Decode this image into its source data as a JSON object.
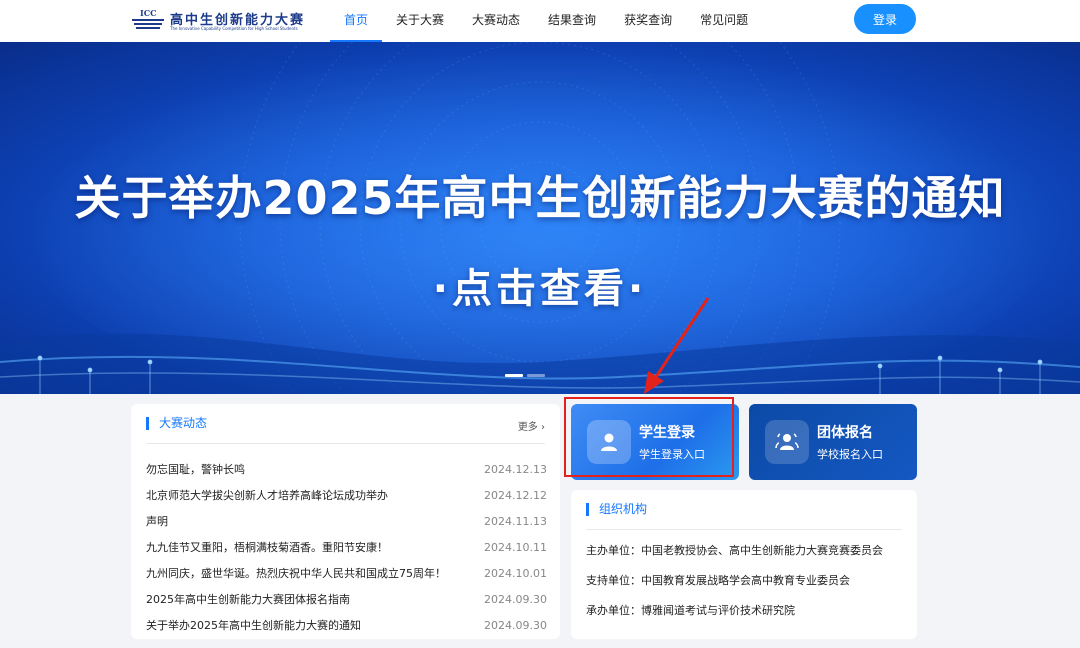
{
  "header": {
    "logo": {
      "abbr": "ICC",
      "name": "高中生创新能力大赛",
      "subtitle": "The Innovative Capability Competition for High School Students"
    },
    "nav": [
      {
        "label": "首页",
        "active": true
      },
      {
        "label": "关于大赛",
        "active": false
      },
      {
        "label": "大赛动态",
        "active": false
      },
      {
        "label": "结果查询",
        "active": false
      },
      {
        "label": "获奖查询",
        "active": false
      },
      {
        "label": "常见问题",
        "active": false
      }
    ],
    "login_label": "登录"
  },
  "banner": {
    "title": "关于举办2025年高中生创新能力大赛的通知",
    "cta": "·点击查看·",
    "slide_count": 2,
    "active_slide": 1
  },
  "news": {
    "title": "大赛动态",
    "more": "更多 ›",
    "items": [
      {
        "title": "勿忘国耻，警钟长鸣",
        "date": "2024.12.13"
      },
      {
        "title": "北京师范大学拔尖创新人才培养高峰论坛成功举办",
        "date": "2024.12.12"
      },
      {
        "title": "声明",
        "date": "2024.11.13"
      },
      {
        "title": "九九佳节又重阳，梧桐满枝菊酒香。重阳节安康！",
        "date": "2024.10.11"
      },
      {
        "title": "九州同庆，盛世华诞。热烈庆祝中华人民共和国成立75周年！",
        "date": "2024.10.01"
      },
      {
        "title": "2025年高中生创新能力大赛团体报名指南",
        "date": "2024.09.30"
      },
      {
        "title": "关于举办2025年高中生创新能力大赛的通知",
        "date": "2024.09.30"
      }
    ]
  },
  "entries": {
    "student": {
      "title": "学生登录",
      "subtitle": "学生登录入口",
      "icon": "user-icon"
    },
    "group": {
      "title": "团体报名",
      "subtitle": "学校报名入口",
      "icon": "group-icon"
    }
  },
  "org": {
    "title": "组织机构",
    "items": [
      "主办单位：中国老教授协会、高中生创新能力大赛竞赛委员会",
      "支持单位：中国教育发展战略学会高中教育专业委员会",
      "承办单位：博雅闻道考试与评价技术研究院"
    ]
  },
  "colors": {
    "primary": "#1677ff",
    "banner": "#1558d6",
    "annotation": "#e3231b"
  }
}
